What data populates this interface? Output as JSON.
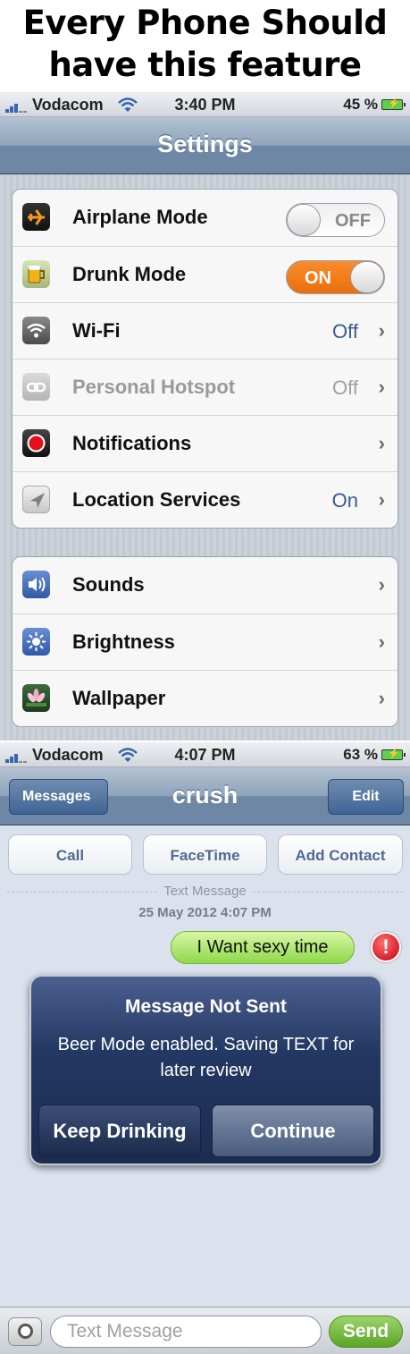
{
  "meme": {
    "line1": "Every Phone Should",
    "line2": "have this feature"
  },
  "status_bar_1": {
    "carrier": "Vodacom",
    "time": "3:40 PM",
    "battery": "45 %"
  },
  "settings": {
    "title": "Settings",
    "group1": [
      {
        "label": "Airplane Mode",
        "toggle": "OFF",
        "icon": "airplane-icon"
      },
      {
        "label": "Drunk Mode",
        "toggle": "ON",
        "icon": "beer-mug-icon"
      },
      {
        "label": "Wi-Fi",
        "value": "Off",
        "icon": "wifi-icon"
      },
      {
        "label": "Personal Hotspot",
        "value": "Off",
        "icon": "hotspot-icon",
        "disabled": true
      },
      {
        "label": "Notifications",
        "value": "",
        "icon": "notifications-icon"
      },
      {
        "label": "Location Services",
        "value": "On",
        "icon": "location-icon"
      }
    ],
    "group2": [
      {
        "label": "Sounds",
        "icon": "speaker-icon"
      },
      {
        "label": "Brightness",
        "icon": "sun-icon"
      },
      {
        "label": "Wallpaper",
        "icon": "flower-icon"
      }
    ],
    "chevron": "›"
  },
  "status_bar_2": {
    "carrier": "Vodacom",
    "time": "4:07 PM",
    "battery": "63 %"
  },
  "messages": {
    "back": "Messages",
    "title": "crush",
    "edit": "Edit",
    "actions": [
      "Call",
      "FaceTime",
      "Add Contact"
    ],
    "timestamp_type": "Text Message",
    "timestamp_date": "25 May 2012 4:07 PM",
    "bubble": "I Want sexy time",
    "error_mark": "!",
    "alert": {
      "title": "Message Not Sent",
      "message": "Beer Mode enabled. Saving TEXT for later review",
      "button_left": "Keep Drinking",
      "button_right": "Continue"
    },
    "input_placeholder": "Text Message",
    "send": "Send"
  },
  "colors": {
    "toggle_on": "#f27d1c",
    "send_green": "#6cb632",
    "nav_blue": "#6d87a4",
    "alert_blue": "#233862"
  }
}
